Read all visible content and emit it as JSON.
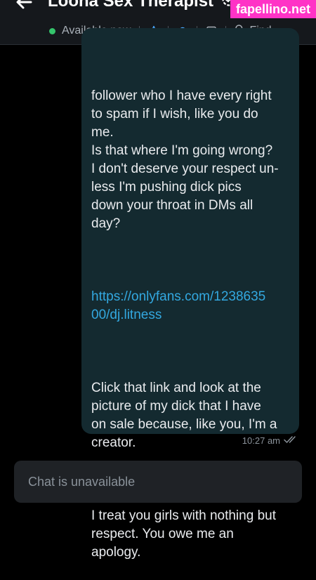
{
  "header": {
    "title": "Loona Sex Therapist",
    "brand": "fapellino.net",
    "status": "Available now",
    "find_label": "Find"
  },
  "message": {
    "text_intro": "follower who I have every right\nto spam if I wish, like you do\nme.\nIs that where I'm going wrong?\nI don't deserve your respect un-\nless I'm pushing dick pics\ndown your throat in DMs all\nday?",
    "link": "https://onlyfans.com/1238635\n00/dj.litness",
    "text_mid": "Click that link and look at the\npicture of my dick that I have\non sale because, like you, I'm a\ncreator.",
    "text_end": "I treat you girls with nothing but\nrespect. You owe me an\napology.",
    "time": "10:27 am"
  },
  "composer": {
    "placeholder": "Chat is unavailable"
  },
  "colors": {
    "background": "#000000",
    "bubble": "#142a30",
    "link": "#33a8e0",
    "online": "#34c46b",
    "brand": "#ff33c6",
    "accent": "#4aa8ff"
  }
}
